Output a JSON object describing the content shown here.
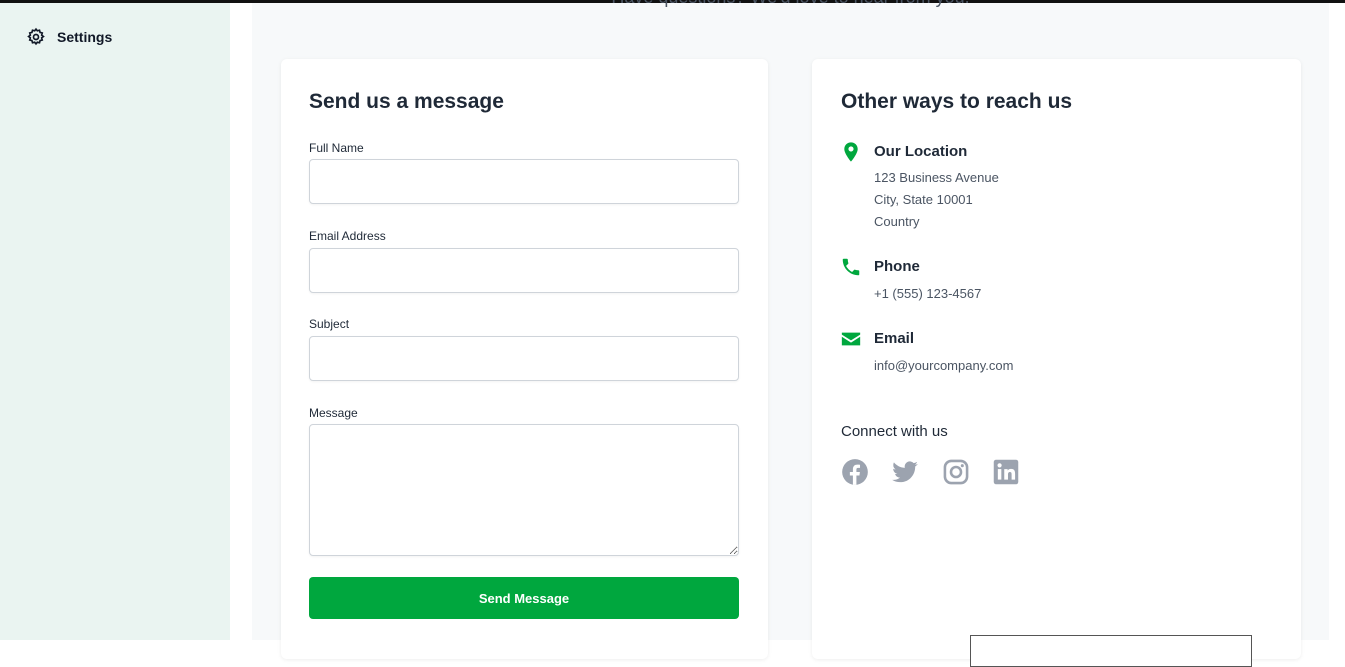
{
  "sidebar": {
    "items": [
      {
        "label": "Settings",
        "icon": "gear-icon"
      }
    ]
  },
  "header": {
    "subtitle": "Have questions? We'd love to hear from you."
  },
  "form": {
    "title": "Send us a message",
    "fields": {
      "full_name": {
        "label": "Full Name",
        "value": "",
        "placeholder": ""
      },
      "email": {
        "label": "Email Address",
        "value": "",
        "placeholder": ""
      },
      "subject": {
        "label": "Subject",
        "value": "",
        "placeholder": ""
      },
      "message": {
        "label": "Message",
        "value": "",
        "placeholder": ""
      }
    },
    "submit_label": "Send Message"
  },
  "contact": {
    "title": "Other ways to reach us",
    "location": {
      "title": "Our Location",
      "icon": "map-pin-icon",
      "lines": [
        "123 Business Avenue",
        "City, State 10001",
        "Country"
      ]
    },
    "phone": {
      "title": "Phone",
      "icon": "phone-icon",
      "value": "+1 (555) 123-4567"
    },
    "email": {
      "title": "Email",
      "icon": "envelope-icon",
      "value": "info@yourcompany.com"
    },
    "connect": {
      "title": "Connect with us",
      "socials": [
        "facebook-icon",
        "twitter-icon",
        "instagram-icon",
        "linkedin-icon"
      ]
    }
  },
  "colors": {
    "accent": "#00a73e",
    "sidebar_bg": "#eaf4f1",
    "social_icon": "#9ca3af"
  }
}
